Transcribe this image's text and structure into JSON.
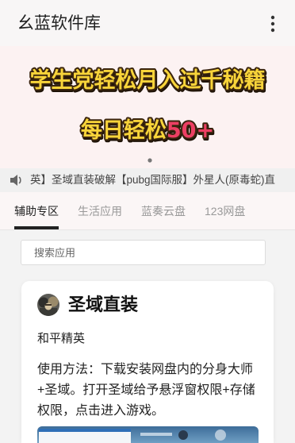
{
  "app_bar": {
    "title": "幺蓝软件库",
    "menu_icon": "more-vert-icon"
  },
  "banner": {
    "line1": "学生党轻松月入过千秘籍",
    "line2": "每日轻松",
    "line2_highlight": "50+"
  },
  "notice": {
    "icon": "speaker-icon",
    "text": "英】圣域直装破解【pubg国际服】外星人(原毒蛇)直"
  },
  "tabs": [
    {
      "label": "辅助专区",
      "active": true
    },
    {
      "label": "生活应用",
      "active": false
    },
    {
      "label": "蓝奏云盘",
      "active": false
    },
    {
      "label": "123网盘",
      "active": false
    }
  ],
  "search": {
    "placeholder": "搜索应用"
  },
  "app_card": {
    "icon": "app-avatar-icon",
    "title": "圣域直装",
    "category": "和平精英",
    "description_lines": [
      "使用方法：下载安装网盘内的分身大师",
      "+圣域。打开圣域给予悬浮窗权限+存储",
      "权限，点击进入游戏。"
    ],
    "screenshot": "game-screenshot-image"
  },
  "theme": {
    "appbar-bg": "#f8f6f6",
    "banner-bg": "#fcf2f2",
    "banner-fill": "#f8d43a",
    "banner-stroke": "#3a240e",
    "banner-hl": "#ec3f63",
    "notice-bg": "#f0f0f0",
    "tab-active": "#222222",
    "tab-inactive": "#999999",
    "content-bg": "#f3f3f3"
  }
}
